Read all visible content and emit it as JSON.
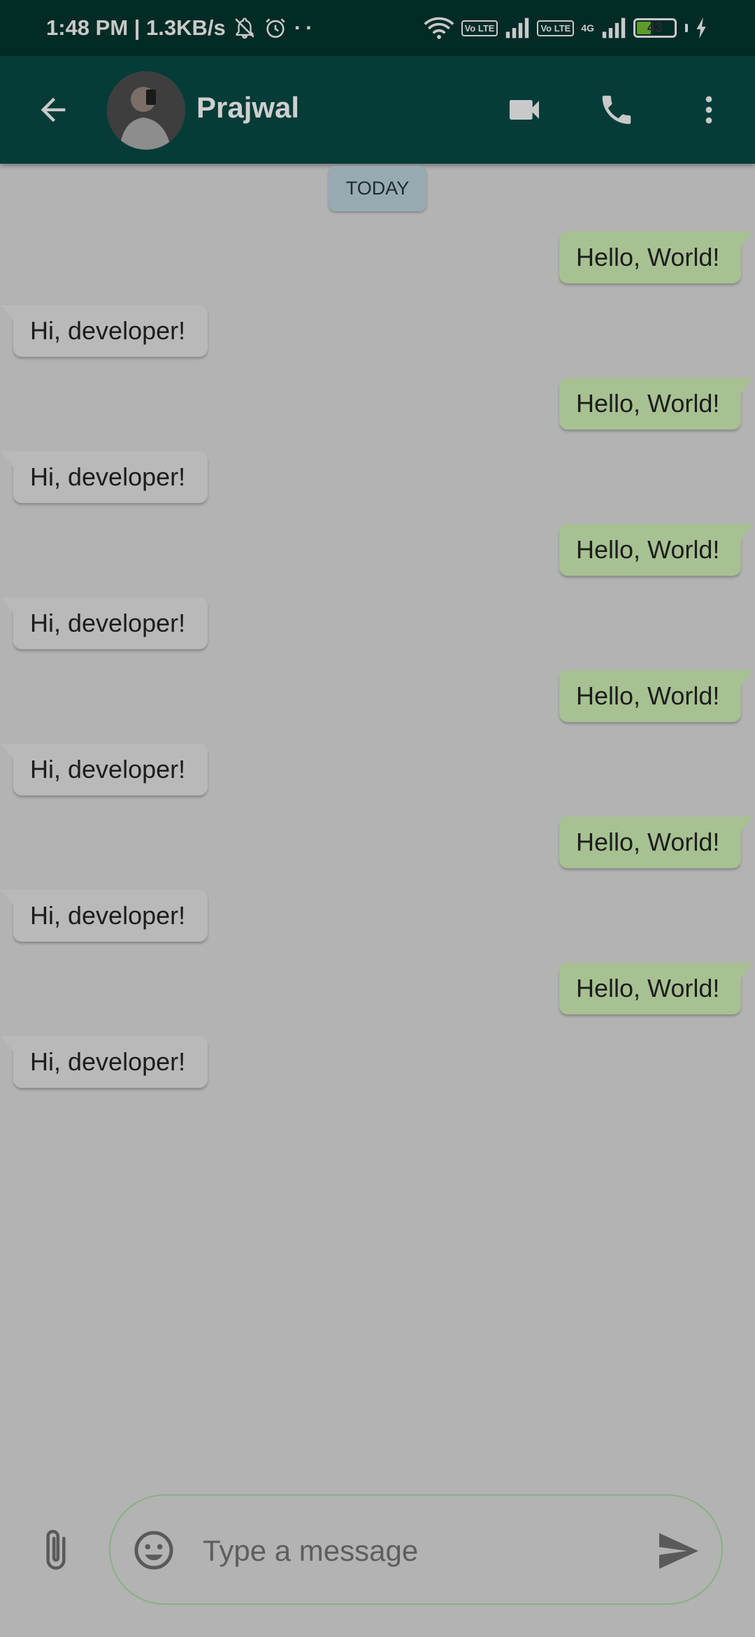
{
  "status_bar": {
    "time_speed": "1:48 PM | 1.3KB/s",
    "dots": "··",
    "volte1": "Vo LTE",
    "volte2": "Vo LTE",
    "network_type": "4G",
    "battery_level": "43",
    "battery_fraction": 0.43,
    "icons": [
      "bell-off-icon",
      "alarm-icon",
      "wifi-icon",
      "signal-icon",
      "signal-icon",
      "charging-icon"
    ]
  },
  "header": {
    "contact_name": "Prajwal",
    "accent_color": "#053c37",
    "icons": [
      "back-arrow-icon",
      "avatar",
      "video-call-icon",
      "phone-icon",
      "more-vert-icon"
    ]
  },
  "chat": {
    "date_label": "TODAY",
    "messages": [
      {
        "direction": "out",
        "text": "Hello, World!"
      },
      {
        "direction": "in",
        "text": "Hi, developer!"
      },
      {
        "direction": "out",
        "text": "Hello, World!"
      },
      {
        "direction": "in",
        "text": "Hi, developer!"
      },
      {
        "direction": "out",
        "text": "Hello, World!"
      },
      {
        "direction": "in",
        "text": "Hi, developer!"
      },
      {
        "direction": "out",
        "text": "Hello, World!"
      },
      {
        "direction": "in",
        "text": "Hi, developer!"
      },
      {
        "direction": "out",
        "text": "Hello, World!"
      },
      {
        "direction": "in",
        "text": "Hi, developer!"
      },
      {
        "direction": "out",
        "text": "Hello, World!"
      },
      {
        "direction": "in",
        "text": "Hi, developer!"
      }
    ],
    "outgoing_color": "#a7c192",
    "incoming_color": "#b9b9b9"
  },
  "composer": {
    "placeholder": "Type a message",
    "icons": [
      "paperclip-icon",
      "emoji-icon",
      "send-icon"
    ]
  }
}
